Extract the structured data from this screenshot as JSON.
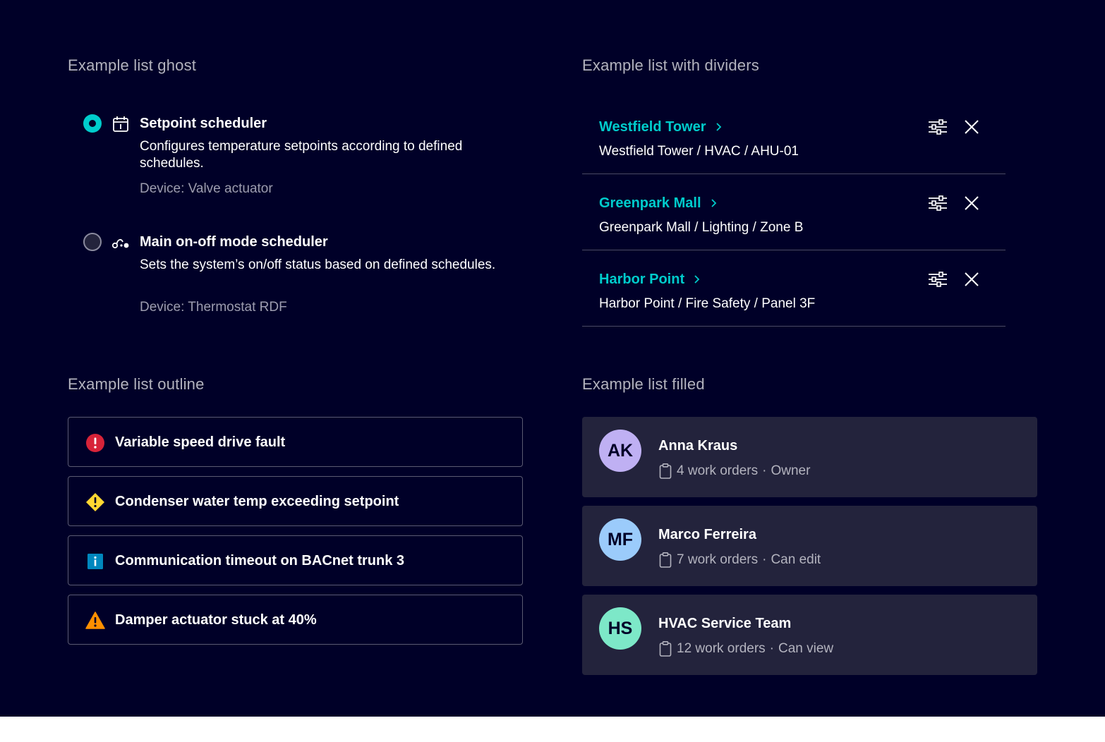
{
  "colors": {
    "background": "#000028",
    "accent": "#00cccc",
    "surface": "#23233c",
    "muted_text": "#9d9daf",
    "error": "#d72339",
    "caution": "#ffd732",
    "info": "#0087be",
    "warning": "#ff9000"
  },
  "ghost": {
    "title": "Example list ghost",
    "items": [
      {
        "selected": true,
        "icon": "calendar-icon",
        "title": "Setpoint scheduler",
        "description": "Configures temperature setpoints according to defined schedules.",
        "meta": "Device: Valve actuator"
      },
      {
        "selected": false,
        "icon": "workflow-icon",
        "title": "Main on-off mode scheduler",
        "description": "Sets the system’s on/off status based on defined schedules.",
        "meta": "Device: Thermostat RDF"
      }
    ]
  },
  "dividers": {
    "title": "Example list with dividers",
    "items": [
      {
        "title": "Westfield Tower",
        "path": "Westfield Tower / HVAC / AHU-01"
      },
      {
        "title": "Greenpark Mall",
        "path": "Greenpark Mall / Lighting / Zone B"
      },
      {
        "title": "Harbor Point",
        "path": "Harbor Point / Fire Safety / Panel 3F"
      }
    ],
    "actions": [
      "settings-sliders-icon",
      "close-icon"
    ]
  },
  "outline": {
    "title": "Example list outline",
    "items": [
      {
        "severity": "error",
        "icon": "error-circle-icon",
        "label": "Variable speed drive fault"
      },
      {
        "severity": "caution",
        "icon": "caution-diamond-icon",
        "label": "Condenser water temp exceeding setpoint"
      },
      {
        "severity": "info",
        "icon": "info-square-icon",
        "label": "Communication timeout on BACnet trunk 3"
      },
      {
        "severity": "warning",
        "icon": "warning-triangle-icon",
        "label": "Damper actuator stuck at 40%"
      }
    ]
  },
  "filled": {
    "title": "Example list filled",
    "items": [
      {
        "initials": "AK",
        "avatar_color": "#bfb0f3",
        "name": "Anna Kraus",
        "work_orders": "4 work orders",
        "role": "Owner"
      },
      {
        "initials": "MF",
        "avatar_color": "#9bcbfb",
        "name": "Marco Ferreira",
        "work_orders": "7 work orders",
        "role": "Can edit"
      },
      {
        "initials": "HS",
        "avatar_color": "#7de8c8",
        "name": "HVAC Service Team",
        "work_orders": "12 work orders",
        "role": "Can view"
      }
    ],
    "separator": "·"
  }
}
